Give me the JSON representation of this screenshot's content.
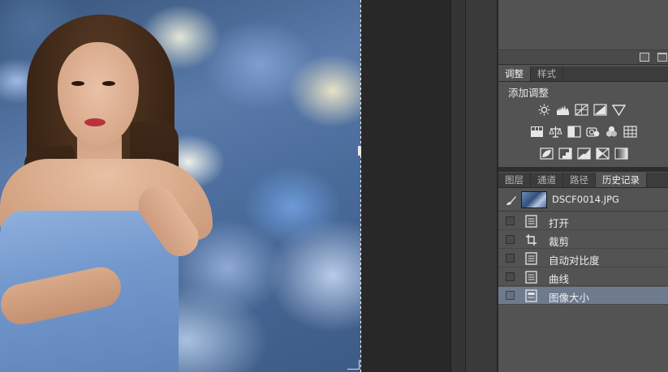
{
  "panels": {
    "adjustments": {
      "tabs": [
        {
          "label": "调整",
          "active": true
        },
        {
          "label": "样式",
          "active": false
        }
      ],
      "title": "添加调整",
      "icons": [
        [
          "brightness-contrast-icon",
          "levels-icon",
          "curves-icon",
          "exposure-icon",
          "vibrance-icon"
        ],
        [
          "hue-saturation-icon",
          "color-balance-icon",
          "black-white-icon",
          "photo-filter-icon",
          "channel-mixer-icon",
          "color-lookup-icon"
        ],
        [
          "invert-icon",
          "posterize-icon",
          "threshold-icon",
          "selective-color-icon",
          "gradient-map-icon"
        ]
      ]
    },
    "history": {
      "tabs": [
        {
          "label": "图层",
          "active": false
        },
        {
          "label": "通道",
          "active": false
        },
        {
          "label": "路径",
          "active": false
        },
        {
          "label": "历史记录",
          "active": true
        }
      ],
      "snapshot": {
        "name": "DSCF0014.JPG"
      },
      "steps": [
        {
          "label": "打开",
          "icon": "document-icon",
          "selected": false
        },
        {
          "label": "裁剪",
          "icon": "crop-icon",
          "selected": false
        },
        {
          "label": "自动对比度",
          "icon": "document-icon",
          "selected": false
        },
        {
          "label": "曲线",
          "icon": "document-icon",
          "selected": false
        },
        {
          "label": "图像大小",
          "icon": "image-size-icon",
          "selected": true
        }
      ]
    }
  },
  "colors": {
    "panel_bg": "#535353",
    "tab_bar_bg": "#3c3c3c",
    "selected_row": "#6e7b8d",
    "workspace_bg": "#282828"
  }
}
